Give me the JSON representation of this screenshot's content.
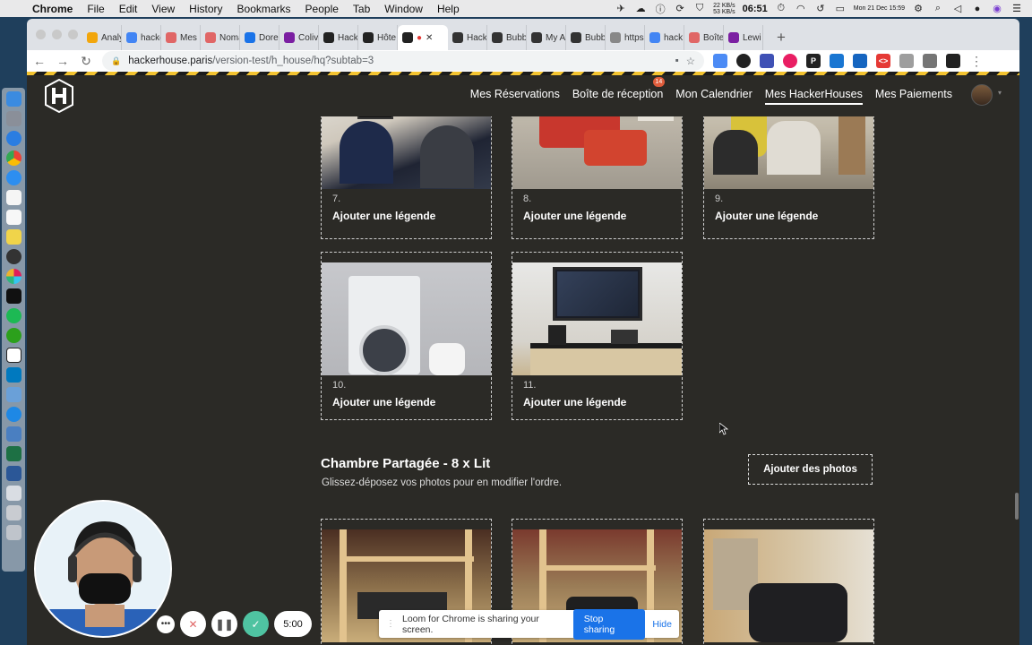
{
  "menubar": {
    "app": "Chrome",
    "items": [
      "File",
      "Edit",
      "View",
      "History",
      "Bookmarks",
      "People",
      "Tab",
      "Window",
      "Help"
    ],
    "net_up": "22 KB/s",
    "net_down": "53 KB/s",
    "time": "06:51",
    "date": "Mon 21 Dec 15:59"
  },
  "browser": {
    "tabs": [
      {
        "label": "Analy",
        "color": "#f2a60c"
      },
      {
        "label": "hacke",
        "color": "#4285f4"
      },
      {
        "label": "Mes c",
        "color": "#e06666"
      },
      {
        "label": "Noma",
        "color": "#e06666"
      },
      {
        "label": "Dore",
        "color": "#1a73e8"
      },
      {
        "label": "Coliv",
        "color": "#7b1fa2"
      },
      {
        "label": "Hack",
        "color": "#222222"
      },
      {
        "label": "Hôte",
        "color": "#222222"
      },
      {
        "label": "",
        "color": "#222222",
        "active": true
      },
      {
        "label": "Hack",
        "color": "#333333"
      },
      {
        "label": "Bubb",
        "color": "#333333"
      },
      {
        "label": "My A",
        "color": "#333333"
      },
      {
        "label": "Bubb",
        "color": "#333333"
      },
      {
        "label": "https",
        "color": "#888888"
      },
      {
        "label": "hack",
        "color": "#4285f4"
      },
      {
        "label": "Boîte",
        "color": "#e06666"
      },
      {
        "label": "Lewi",
        "color": "#7b1fa2"
      }
    ],
    "url_host": "hackerhouse.paris",
    "url_path": "/version-test/h_house/hq?subtab=3"
  },
  "nav": {
    "links": [
      "Mes Réservations",
      "Boîte de réception",
      "Mon Calendrier",
      "Mes HackerHouses",
      "Mes Paiements"
    ],
    "active_index": 3,
    "badge": "14"
  },
  "photos": [
    {
      "num": "7.",
      "caption": "Ajouter une légende"
    },
    {
      "num": "8.",
      "caption": "Ajouter une légende"
    },
    {
      "num": "9.",
      "caption": "Ajouter une légende"
    },
    {
      "num": "10.",
      "caption": "Ajouter une légende"
    },
    {
      "num": "11.",
      "caption": "Ajouter une légende"
    }
  ],
  "section": {
    "title": "Chambre Partagée - 8 x Lit",
    "subtitle": "Glissez-déposez vos photos pour en modifier l'ordre.",
    "add_button": "Ajouter des photos"
  },
  "loom": {
    "timer": "5:00",
    "share_text": "Loom for Chrome is sharing your screen.",
    "stop_label": "Stop sharing",
    "hide_label": "Hide"
  }
}
